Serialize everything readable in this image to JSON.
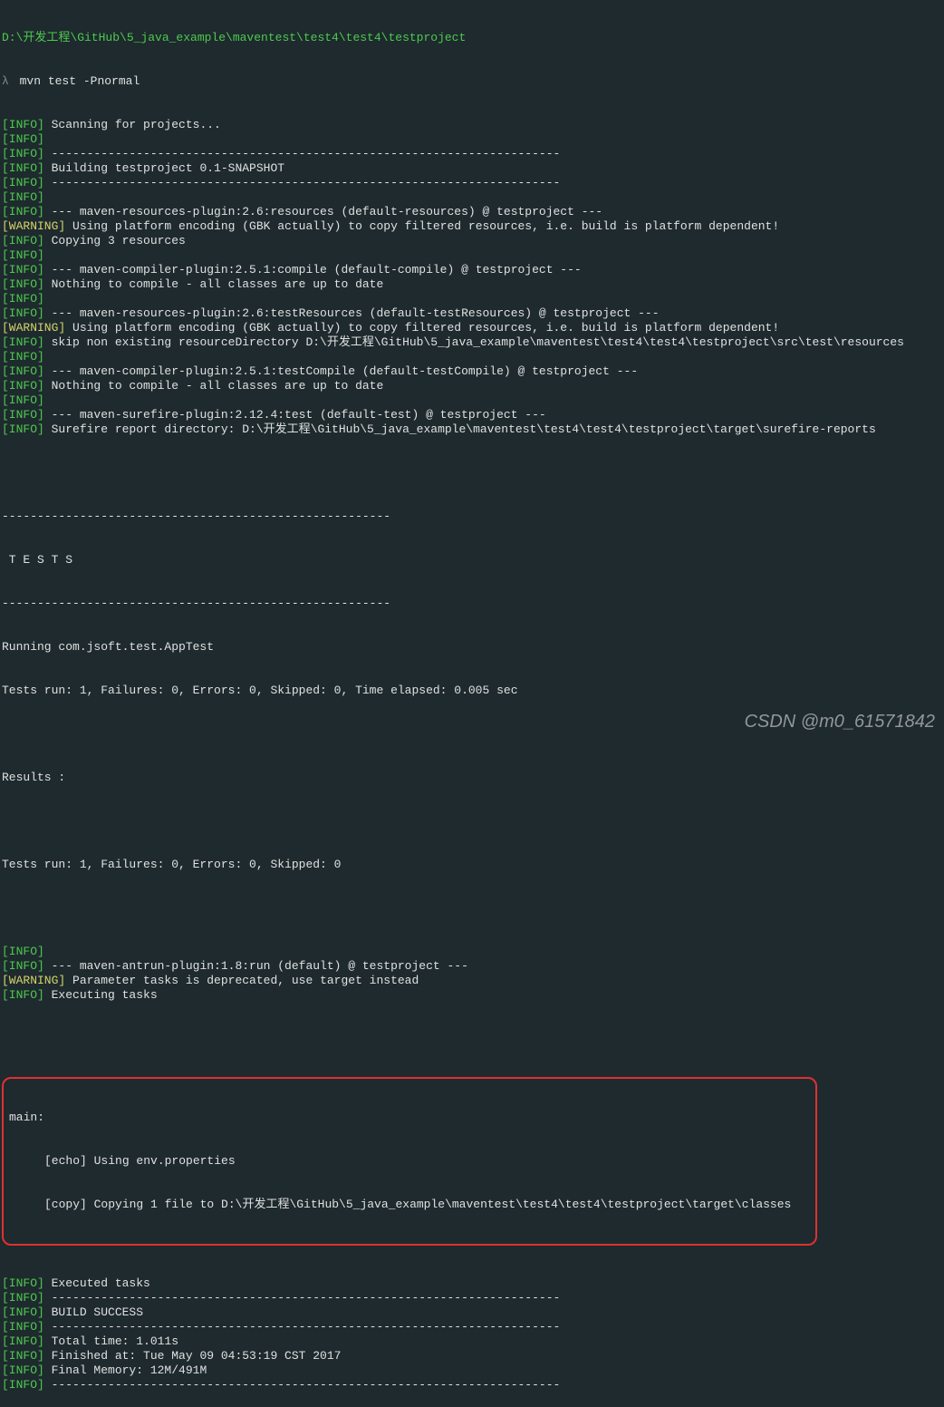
{
  "path": "D:\\开发工程\\GitHub\\5_java_example\\maventest\\test4\\test4\\testproject",
  "prompt_symbol": "λ",
  "command": "mvn test -Pnormal",
  "lines": [
    {
      "tag": "[INFO]",
      "text": " Scanning for projects..."
    },
    {
      "tag": "[INFO]",
      "text": ""
    },
    {
      "tag": "[INFO]",
      "text": " ------------------------------------------------------------------------"
    },
    {
      "tag": "[INFO]",
      "text": " Building testproject 0.1-SNAPSHOT"
    },
    {
      "tag": "[INFO]",
      "text": " ------------------------------------------------------------------------"
    },
    {
      "tag": "[INFO]",
      "text": ""
    },
    {
      "tag": "[INFO]",
      "text": " --- maven-resources-plugin:2.6:resources (default-resources) @ testproject ---"
    },
    {
      "tag": "[WARNING]",
      "text": " Using platform encoding (GBK actually) to copy filtered resources, i.e. build is platform dependent!"
    },
    {
      "tag": "[INFO]",
      "text": " Copying 3 resources"
    },
    {
      "tag": "[INFO]",
      "text": ""
    },
    {
      "tag": "[INFO]",
      "text": " --- maven-compiler-plugin:2.5.1:compile (default-compile) @ testproject ---"
    },
    {
      "tag": "[INFO]",
      "text": " Nothing to compile - all classes are up to date"
    },
    {
      "tag": "[INFO]",
      "text": ""
    },
    {
      "tag": "[INFO]",
      "text": " --- maven-resources-plugin:2.6:testResources (default-testResources) @ testproject ---"
    },
    {
      "tag": "[WARNING]",
      "text": " Using platform encoding (GBK actually) to copy filtered resources, i.e. build is platform dependent!"
    },
    {
      "tag": "[INFO]",
      "text": " skip non existing resourceDirectory D:\\开发工程\\GitHub\\5_java_example\\maventest\\test4\\test4\\testproject\\src\\test\\resources"
    },
    {
      "tag": "[INFO]",
      "text": ""
    },
    {
      "tag": "[INFO]",
      "text": " --- maven-compiler-plugin:2.5.1:testCompile (default-testCompile) @ testproject ---"
    },
    {
      "tag": "[INFO]",
      "text": " Nothing to compile - all classes are up to date"
    },
    {
      "tag": "[INFO]",
      "text": ""
    },
    {
      "tag": "[INFO]",
      "text": " --- maven-surefire-plugin:2.12.4:test (default-test) @ testproject ---"
    },
    {
      "tag": "[INFO]",
      "text": " Surefire report directory: D:\\开发工程\\GitHub\\5_java_example\\maventest\\test4\\test4\\testproject\\target\\surefire-reports"
    }
  ],
  "tests_block": {
    "dash1": "-------------------------------------------------------",
    "header": " T E S T S",
    "dash2": "-------------------------------------------------------",
    "running": "Running com.jsoft.test.AppTest",
    "run1": "Tests run: 1, Failures: 0, Errors: 0, Skipped: 0, Time elapsed: 0.005 sec",
    "results": "Results :",
    "run2": "Tests run: 1, Failures: 0, Errors: 0, Skipped: 0"
  },
  "lines2": [
    {
      "tag": "[INFO]",
      "text": ""
    },
    {
      "tag": "[INFO]",
      "text": " --- maven-antrun-plugin:1.8:run (default) @ testproject ---"
    },
    {
      "tag": "[WARNING]",
      "text": " Parameter tasks is deprecated, use target instead"
    },
    {
      "tag": "[INFO]",
      "text": " Executing tasks"
    }
  ],
  "highlight": {
    "l1": "main:",
    "l2": "     [echo] Using env.properties",
    "l3": "     [copy] Copying 1 file to D:\\开发工程\\GitHub\\5_java_example\\maventest\\test4\\test4\\testproject\\target\\classes"
  },
  "lines3": [
    {
      "tag": "[INFO]",
      "text": " Executed tasks"
    },
    {
      "tag": "[INFO]",
      "text": " ------------------------------------------------------------------------"
    },
    {
      "tag": "[INFO]",
      "text": " BUILD SUCCESS"
    },
    {
      "tag": "[INFO]",
      "text": " ------------------------------------------------------------------------"
    },
    {
      "tag": "[INFO]",
      "text": " Total time: 1.011s"
    },
    {
      "tag": "[INFO]",
      "text": " Finished at: Tue May 09 04:53:19 CST 2017"
    },
    {
      "tag": "[INFO]",
      "text": " Final Memory: 12M/491M"
    },
    {
      "tag": "[INFO]",
      "text": " ------------------------------------------------------------------------"
    }
  ],
  "watermark": "CSDN @m0_61571842"
}
